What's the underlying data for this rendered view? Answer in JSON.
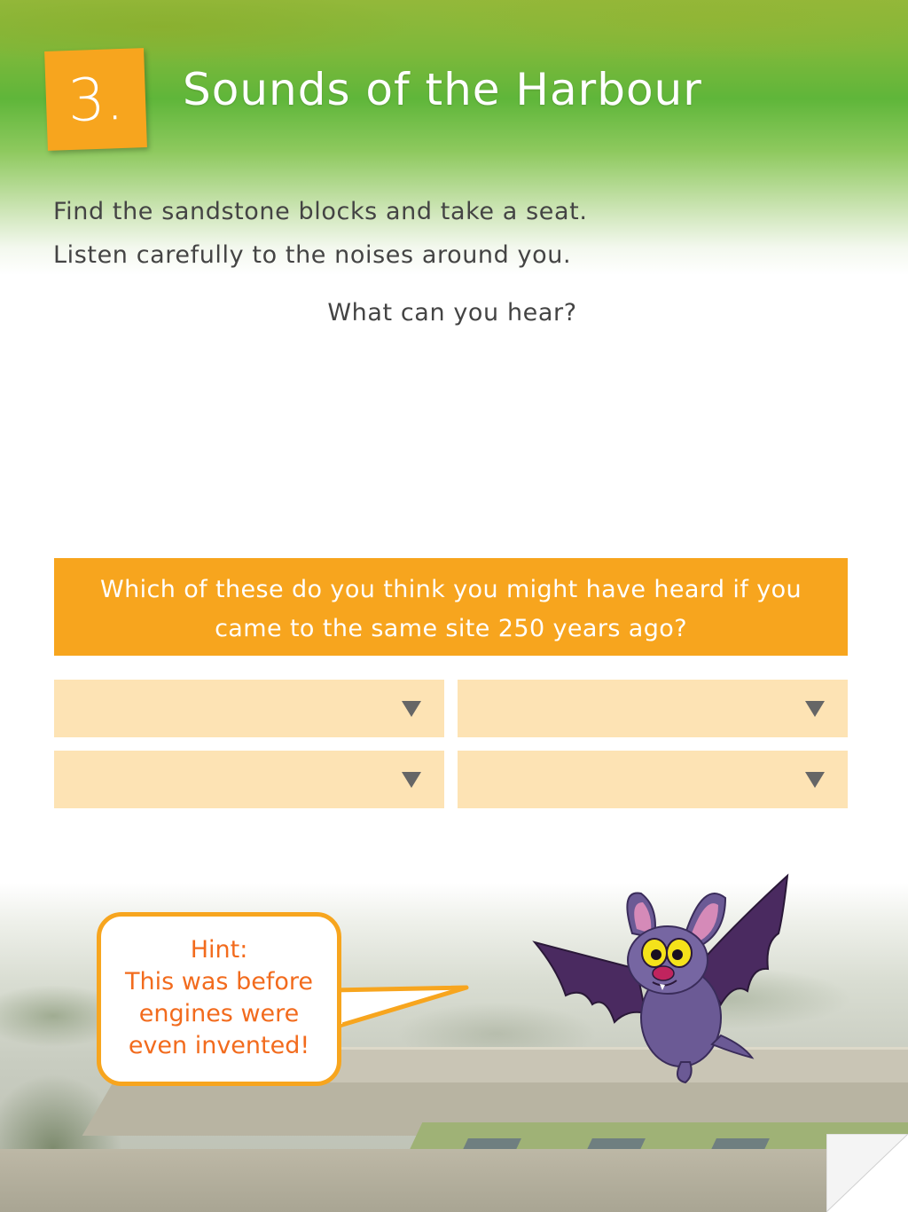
{
  "header": {
    "number": "3.",
    "title": "Sounds of the Harbour"
  },
  "intro": {
    "line1": "Find the sandstone blocks and take a seat.",
    "line2": "Listen carefully to the noises around you."
  },
  "prompt": "What can you hear?",
  "question": "Which of these do you think you might have heard if you came to the same site 250 years ago?",
  "dropdowns": [
    {
      "value": ""
    },
    {
      "value": ""
    },
    {
      "value": ""
    },
    {
      "value": ""
    }
  ],
  "hint": {
    "label": "Hint:",
    "line1": "This was before",
    "line2": "engines were",
    "line3": "even invented!"
  },
  "colors": {
    "accent_orange": "#f7a51e",
    "dropdown_fill": "#fde3b4",
    "hint_text": "#f26b1d",
    "header_green": "#5fb63a"
  },
  "icons": {
    "dropdown_arrow": "chevron-down-icon",
    "mascot": "bat-mascot",
    "page_curl": "page-turn-icon"
  }
}
